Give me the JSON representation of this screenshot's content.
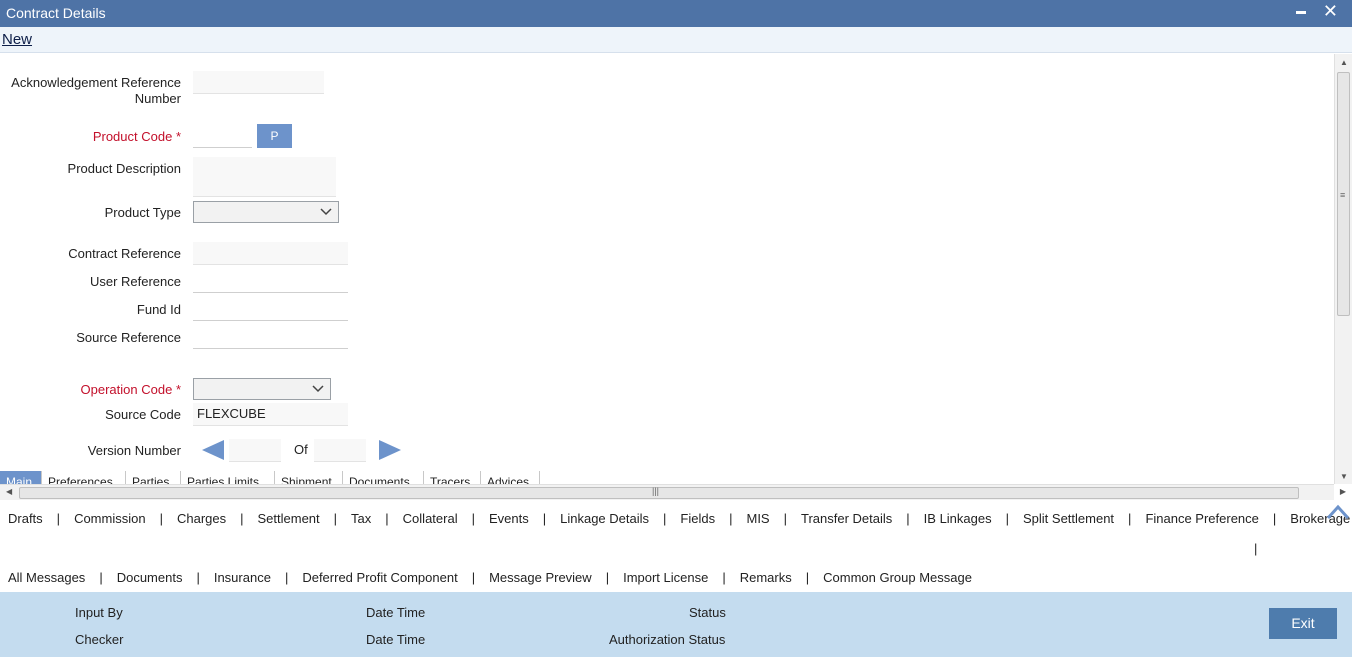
{
  "window": {
    "title": "Contract Details"
  },
  "toolbar": {
    "new_label": "New"
  },
  "form": {
    "ack_ref_label_line1": "Acknowledgement Reference",
    "ack_ref_label_line2": "Number",
    "ack_ref_value": "",
    "product_code_label": "Product Code",
    "product_code_value": "",
    "p_button_label": "P",
    "product_desc_label": "Product Description",
    "product_desc_value": "",
    "product_type_label": "Product Type",
    "product_type_value": "",
    "contract_ref_label": "Contract Reference",
    "contract_ref_value": "",
    "user_ref_label": "User Reference",
    "user_ref_value": "",
    "fund_id_label": "Fund Id",
    "fund_id_value": "",
    "source_ref_label": "Source Reference",
    "source_ref_value": "",
    "operation_code_label": "Operation Code",
    "operation_code_value": "",
    "source_code_label": "Source Code",
    "source_code_value": "FLEXCUBE",
    "version_label": "Version Number",
    "version_value": "",
    "of_label": "Of",
    "of_value": "",
    "required_marker": "*"
  },
  "tabs": [
    "Main",
    "Preferences",
    "Parties",
    "Parties Limits",
    "Shipment",
    "Documents",
    "Tracers",
    "Advices"
  ],
  "links_row1": [
    "Drafts",
    "Commission",
    "Charges",
    "Settlement",
    "Tax",
    "Collateral",
    "Events",
    "Linkage Details",
    "Fields",
    "MIS",
    "Transfer Details",
    "IB Linkages",
    "Split Settlement",
    "Finance Preference",
    "Brokerage"
  ],
  "links_row1_extra_sep": "|",
  "links_row2": [
    "All Messages",
    "Documents",
    "Insurance",
    "Deferred Profit Component",
    "Message Preview",
    "Import License",
    "Remarks",
    "Common Group Message"
  ],
  "footer": {
    "input_by": "Input By",
    "date_time_1": "Date Time",
    "status": "Status",
    "checker": "Checker",
    "date_time_2": "Date Time",
    "auth_status": "Authorization Status",
    "exit_label": "Exit"
  },
  "colors": {
    "titlebar": "#4e73a6",
    "accent": "#6d93cb",
    "required": "#c3102b",
    "footer": "#c4dcef"
  }
}
